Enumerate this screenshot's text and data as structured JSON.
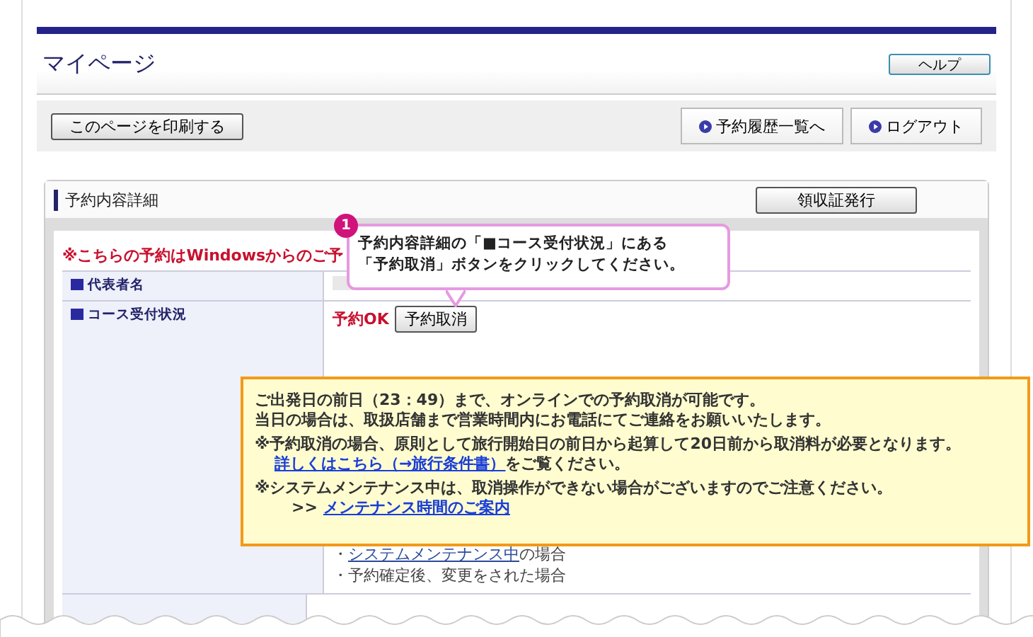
{
  "header": {
    "title": "マイページ",
    "help_button": "ヘルプ"
  },
  "toolbar": {
    "print_button": "このページを印刷する",
    "nav_buttons": [
      "予約履歴一覧へ",
      "ログアウト"
    ]
  },
  "panel": {
    "title": "予約内容詳細",
    "receipt_button": "領収証発行",
    "notice": "※こちらの予約はWindowsからのご予",
    "rows": [
      {
        "label": "代表者名",
        "kind": "blurred"
      },
      {
        "label": "コース受付状況",
        "kind": "status",
        "status": "予約OK",
        "button": "予約取消",
        "notes": [
          {
            "prefix": "・",
            "link": "システムメンテナンス中",
            "suffix": "の場合"
          },
          {
            "prefix": "・予約確定後、変更をされた場合"
          }
        ]
      }
    ]
  },
  "callout": {
    "badge": "1",
    "lines": [
      "予約内容詳細の「■コース受付状況」にある",
      "「予約取消」ボタンをクリックしてください。"
    ]
  },
  "info_box": {
    "lines": [
      {
        "kind": "text",
        "text": "ご出発日の前日（23：49）まで、オンラインでの予約取消が可能です。"
      },
      {
        "kind": "text",
        "text": "当日の場合は、取扱店舗まで営業時間内にお電話にてご連絡をお願いいたします。"
      },
      {
        "kind": "note",
        "text": "※予約取消の場合、原則として旅行開始日の前日から起算して20日前から取消料が必要となります。"
      },
      {
        "kind": "link",
        "link": "詳しくはこちら（→旅行条件書）",
        "suffix": "をご覧ください。"
      },
      {
        "kind": "note",
        "text": "※システムメンテナンス中は、取消操作ができない場合がございますのでご注意ください。"
      },
      {
        "kind": "more",
        "marker": ">>",
        "link": "メンテナンス時間のご案内"
      }
    ]
  }
}
